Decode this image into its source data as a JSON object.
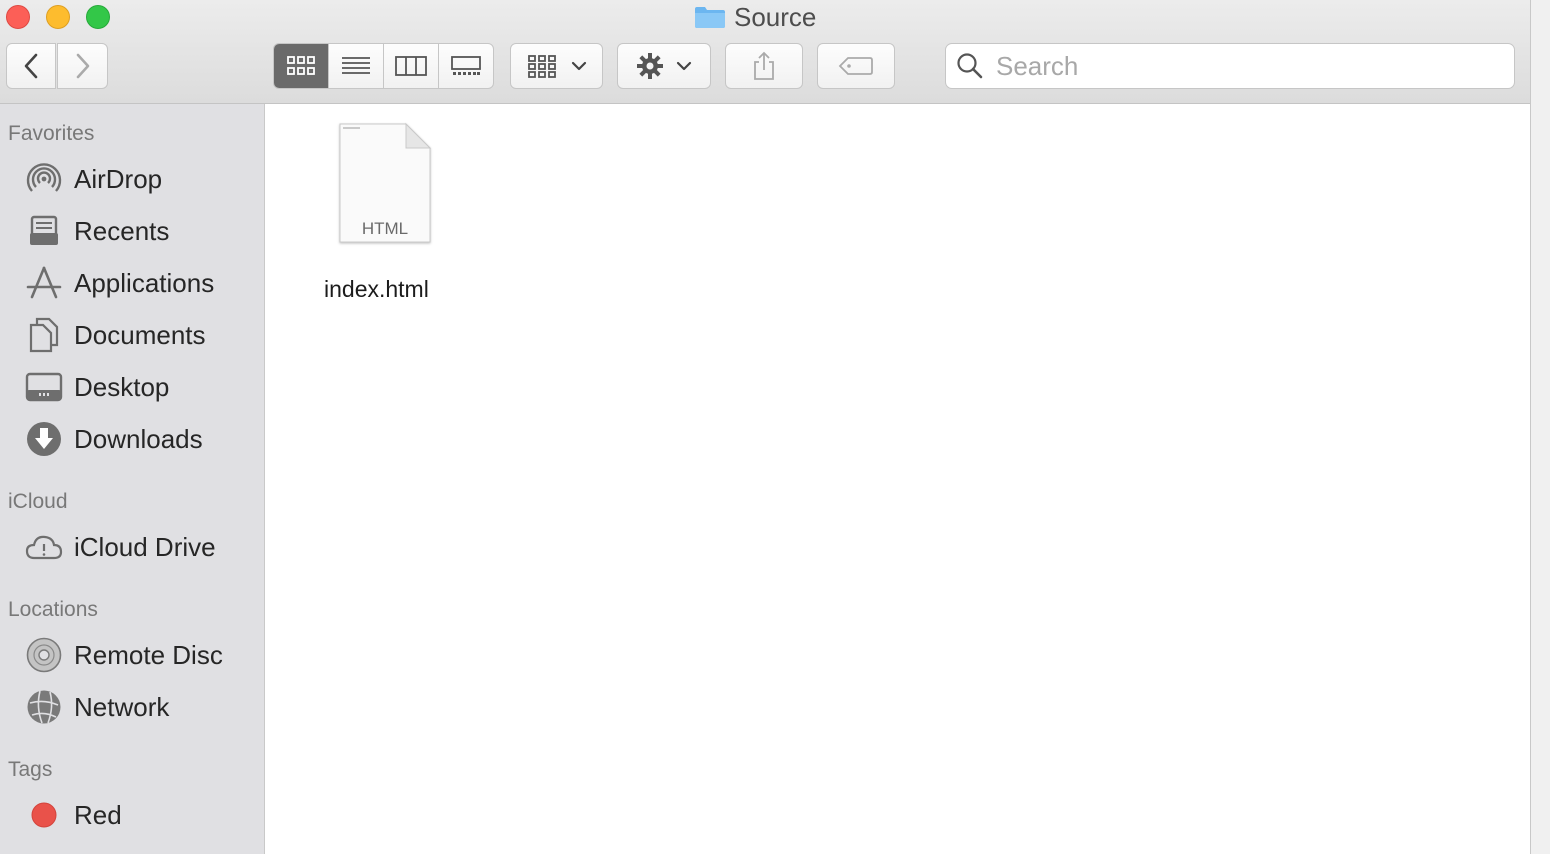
{
  "window": {
    "title": "Source"
  },
  "toolbar": {
    "back_icon": "chevron-left-icon",
    "forward_icon": "chevron-right-icon",
    "view_modes": [
      "icon-view-icon",
      "list-view-icon",
      "column-view-icon",
      "gallery-view-icon"
    ],
    "active_view": "icon-view-icon",
    "arrange_icon": "group-by-icon",
    "action_icon": "gear-icon",
    "share_icon": "share-icon",
    "tag_icon": "tag-icon",
    "search_placeholder": "Search"
  },
  "sidebar": {
    "favorites_header": "Favorites",
    "favorites": [
      {
        "label": "AirDrop",
        "icon": "airdrop-icon"
      },
      {
        "label": "Recents",
        "icon": "recents-icon"
      },
      {
        "label": "Applications",
        "icon": "applications-icon"
      },
      {
        "label": "Documents",
        "icon": "documents-icon"
      },
      {
        "label": "Desktop",
        "icon": "desktop-icon"
      },
      {
        "label": "Downloads",
        "icon": "downloads-icon"
      }
    ],
    "icloud_header": "iCloud",
    "icloud": [
      {
        "label": "iCloud Drive",
        "icon": "icloud-drive-icon"
      }
    ],
    "locations_header": "Locations",
    "locations": [
      {
        "label": "Remote Disc",
        "icon": "remote-disc-icon"
      },
      {
        "label": "Network",
        "icon": "network-icon"
      }
    ],
    "tags_header": "Tags",
    "tags": [
      {
        "label": "Red",
        "color": "#e9524a"
      }
    ]
  },
  "content": {
    "files": [
      {
        "name": "index.html",
        "type_label": "HTML",
        "icon": "html-document-icon"
      }
    ]
  },
  "colors": {
    "folder_blue": "#6cb6f0",
    "active_segment": "#6a6a6a",
    "sidebar_bg": "#e0e0e3"
  }
}
